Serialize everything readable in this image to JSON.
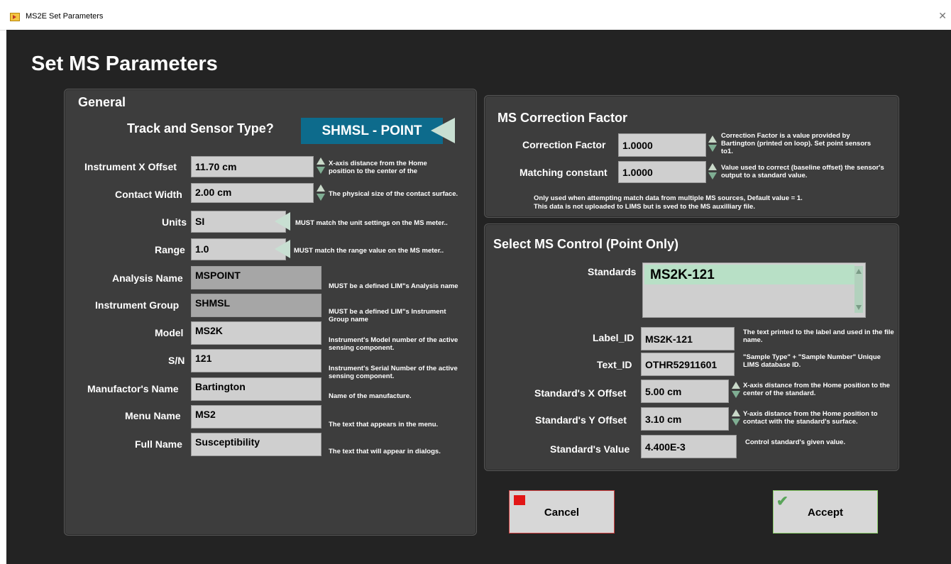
{
  "window": {
    "title": "MS2E Set Parameters",
    "close_glyph": "✕"
  },
  "page_title": "Set MS Parameters",
  "general": {
    "title": "General",
    "track_sensor": {
      "label": "Track and Sensor Type?",
      "value": "SHMSL - POINT"
    },
    "x_offset": {
      "label": "Instrument X Offset",
      "value": "11.70 cm",
      "desc": "X-axis distance from the Home position to the center of the instrument."
    },
    "contact_width": {
      "label": "Contact Width",
      "value": "2.00 cm",
      "desc": "The physical size of the contact surface."
    },
    "units": {
      "label": "Units",
      "value": "SI",
      "desc": "MUST match the unit settings on the MS meter.."
    },
    "range": {
      "label": "Range",
      "value": "1.0",
      "desc": "MUST match the range value on the MS meter.."
    },
    "analysis_name": {
      "label": "Analysis Name",
      "value": "MSPOINT",
      "desc": "MUST be a defined LIM\"s Analysis name"
    },
    "instrument_group": {
      "label": "Instrument Group",
      "value": "SHMSL",
      "desc": "MUST be a defined LIM\"s Instrument Group name"
    },
    "model": {
      "label": "Model",
      "value": "MS2K",
      "desc": "Instrument's Model number of the active sensing component."
    },
    "sn": {
      "label": "S/N",
      "value": "121",
      "desc": "Instrument's Serial Number of the active sensing component."
    },
    "manufacturer": {
      "label": "Manufactor's Name",
      "value": "Bartington",
      "desc": "Name of the manufacture."
    },
    "menu_name": {
      "label": "Menu Name",
      "value": "MS2",
      "desc": "The text that appears in the menu."
    },
    "full_name": {
      "label": "Full Name",
      "value": "Susceptibility",
      "desc": "The text that will appear in dialogs."
    }
  },
  "correction": {
    "title": "MS Correction Factor",
    "factor": {
      "label": "Correction Factor",
      "value": "1.0000",
      "desc": "Correction Factor is a value provided by Bartington (printed on loop). Set point sensors to1."
    },
    "matching": {
      "label": "Matching constant",
      "value": "1.0000",
      "desc": "Value used to correct (baseline offset) the sensor's output to a standard value."
    },
    "note_1": "Only used when attempting match data from multiple MS sources,  Default  value = 1.",
    "note_2": "This data is not uploaded to LIMS but is sved to the MS auxilliary file."
  },
  "control": {
    "title": "Select MS Control (Point Only)",
    "standards_label": "Standards",
    "standards_selected": "MS2K-121",
    "label_id": {
      "label": "Label_ID",
      "value": "MS2K-121",
      "desc": "The text printed to the label and used in the file name."
    },
    "text_id": {
      "label": "Text_ID",
      "value": "OTHR52911601",
      "desc": "\"Sample Type\" + \"Sample Number\" Unique LIMS database ID."
    },
    "std_x": {
      "label": "Standard's X Offset",
      "value": "5.00 cm",
      "desc": "X-axis distance from the Home position to the center of the standard."
    },
    "std_y": {
      "label": "Standard's Y Offset",
      "value": "3.10 cm",
      "desc": "Y-axis distance from the Home position to contact with the standard's surface."
    },
    "std_value": {
      "label": "Standard's Value",
      "value": "4.400E-3",
      "desc": "Control standard's given value."
    }
  },
  "buttons": {
    "cancel": "Cancel",
    "accept": "Accept"
  },
  "colors": {
    "background": "#232323",
    "panel": "#3d3d3d",
    "sensor_box": "#0d6b8c",
    "cancel_indicator": "#e21616",
    "accept_indicator": "#5aa55a"
  }
}
